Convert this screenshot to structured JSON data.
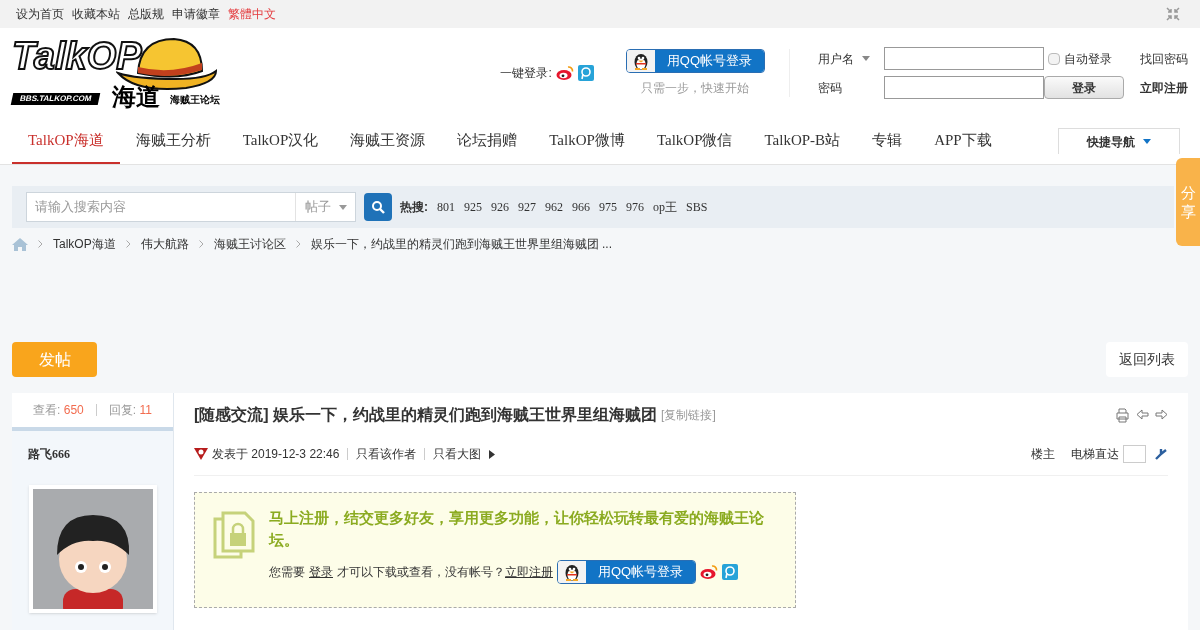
{
  "top_links": [
    {
      "label": "设为首页",
      "kind": "normal"
    },
    {
      "label": "收藏本站",
      "kind": "normal"
    },
    {
      "label": "总版规",
      "kind": "normal"
    },
    {
      "label": "申请徽章",
      "kind": "normal"
    },
    {
      "label": "繁體中文",
      "kind": "highlight"
    }
  ],
  "logo": {
    "main": "TalkOP",
    "domain": "BBS.TALKOP.COM",
    "name": "海道",
    "tagline": "海贼王论坛"
  },
  "quick_login": {
    "label": "一键登录:",
    "qq_button": "用QQ帐号登录",
    "hint": "只需一步，快速开始"
  },
  "login": {
    "username_label": "用户名",
    "password_label": "密码",
    "auto_login": {
      "label": "自动登录",
      "checked": false
    },
    "forgot": "找回密码",
    "submit": "登录",
    "register": "立即注册"
  },
  "nav": [
    {
      "label": "TalkOP海道",
      "selected": true
    },
    {
      "label": "海贼王分析",
      "selected": false
    },
    {
      "label": "TalkOP汉化",
      "selected": false
    },
    {
      "label": "海贼王资源",
      "selected": false
    },
    {
      "label": "论坛捐赠",
      "selected": false
    },
    {
      "label": "TalkOP微博",
      "selected": false
    },
    {
      "label": "TalkOP微信",
      "selected": false
    },
    {
      "label": "TalkOP-B站",
      "selected": false
    },
    {
      "label": "专辑",
      "selected": false
    },
    {
      "label": "APP下载",
      "selected": false
    }
  ],
  "quick_nav": "快捷导航",
  "share_tab": "分享",
  "search": {
    "placeholder": "请输入搜索内容",
    "scope": "帖子",
    "hot_label": "热搜:",
    "hot": [
      "801",
      "925",
      "926",
      "927",
      "962",
      "966",
      "975",
      "976",
      "op王",
      "SBS"
    ]
  },
  "breadcrumb": [
    "TalkOP海道",
    "伟大航路",
    "海贼王讨论区",
    "娱乐一下，约战里的精灵们跑到海贼王世界里组海贼团 ..."
  ],
  "post_button": "发帖",
  "back_button": "返回列表",
  "stats": {
    "views_label": "查看:",
    "views": "650",
    "replies_label": "回复:",
    "replies": "11"
  },
  "author": "路飞666",
  "thread": {
    "title": "[随感交流] 娱乐一下，约战里的精灵们跑到海贼王世界里组海贼团",
    "copy_link": "[复制链接]",
    "posted": "发表于 2019-12-3 22:46",
    "only_author": "只看该作者",
    "big_images": "只看大图",
    "floor": "楼主",
    "jump_label": "电梯直达"
  },
  "notice": {
    "headline": "马上注册，结交更多好友，享用更多功能，让你轻松玩转最有爱的海贼王论坛。",
    "text_before": "您需要",
    "login_link": "登录",
    "text_middle": "才可以下载或查看，没有帐号？",
    "register_link": "立即注册",
    "qq_button": "用QQ帐号登录"
  }
}
